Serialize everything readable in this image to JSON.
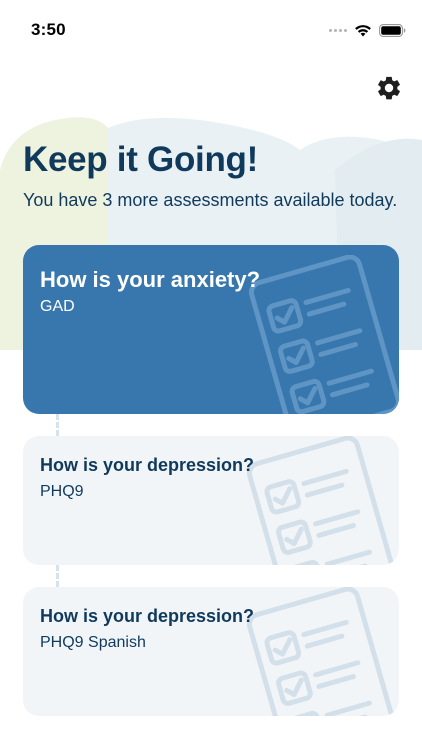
{
  "status_bar": {
    "time": "3:50"
  },
  "header": {
    "title": "Keep it Going!",
    "subtitle": "You have 3 more assessments available today."
  },
  "assessments": [
    {
      "title": "How is your anxiety?",
      "code": "GAD",
      "state": "active"
    },
    {
      "title": "How is your depression?",
      "code": "PHQ9",
      "state": "inactive"
    },
    {
      "title": "How is your depression?",
      "code": "PHQ9 Spanish",
      "state": "inactive"
    }
  ],
  "colors": {
    "primary": "#3777ad",
    "title": "#103a5c",
    "card_inactive": "#f2f5f8",
    "blob_green": "#eef3df",
    "blob_blue": "#e9f1f5"
  },
  "icons": {
    "settings": "gear-icon",
    "wifi": "wifi-icon",
    "battery": "battery-icon",
    "illustration": "checklist-icon"
  }
}
